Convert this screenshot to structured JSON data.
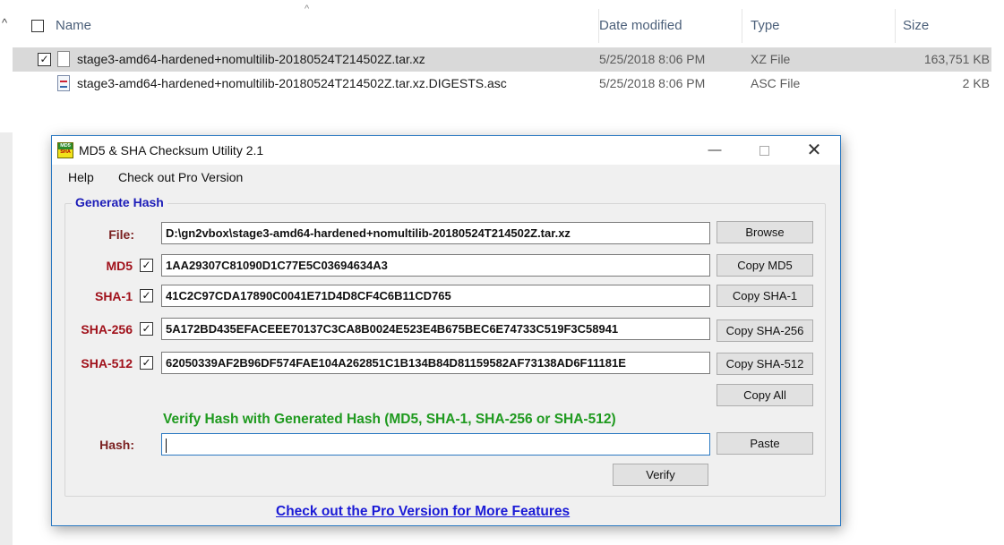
{
  "explorer": {
    "columns": {
      "name": "Name",
      "date": "Date modified",
      "type": "Type",
      "size": "Size"
    },
    "files": [
      {
        "name": "stage3-amd64-hardened+nomultilib-20180524T214502Z.tar.xz",
        "date": "5/25/2018 8:06 PM",
        "type": "XZ File",
        "size": "163,751 KB",
        "selected": true
      },
      {
        "name": "stage3-amd64-hardened+nomultilib-20180524T214502Z.tar.xz.DIGESTS.asc",
        "date": "5/25/2018 8:06 PM",
        "type": "ASC File",
        "size": "2 KB",
        "selected": false
      }
    ]
  },
  "window": {
    "title": "MD5 & SHA Checksum Utility 2.1",
    "icon_text_top": "MD5",
    "icon_text_bottom": "SHA",
    "min_glyph": "—",
    "close_glyph": "✕",
    "menu": [
      "Help",
      "Check out Pro Version"
    ]
  },
  "generate": {
    "group_title": "Generate Hash",
    "file_label": "File:",
    "file_path": "D:\\gn2vbox\\stage3-amd64-hardened+nomultilib-20180524T214502Z.tar.xz",
    "browse_label": "Browse",
    "rows": [
      {
        "label": "MD5",
        "checked": true,
        "value": "1AA29307C81090D1C77E5C03694634A3",
        "button": "Copy MD5"
      },
      {
        "label": "SHA-1",
        "checked": true,
        "value": "41C2C97CDA17890C0041E71D4D8CF4C6B11CD765",
        "button": "Copy SHA-1"
      },
      {
        "label": "SHA-256",
        "checked": true,
        "value": "5A172BD435EFACEEE70137C3CA8B0024E523E4B675BEC6E74733C519F3C58941",
        "button": "Copy SHA-256"
      },
      {
        "label": "SHA-512",
        "checked": true,
        "value": "62050339AF2B96DF574FAE104A262851C1B134B84D81159582AF73138AD6F11181E",
        "button": "Copy SHA-512"
      }
    ],
    "copy_all_label": "Copy All"
  },
  "verify": {
    "heading": "Verify Hash with Generated Hash (MD5, SHA-1, SHA-256 or SHA-512)",
    "hash_label": "Hash:",
    "hash_value": "",
    "paste_label": "Paste",
    "verify_label": "Verify"
  },
  "footer": {
    "pro_link": "Check out the Pro Version for More Features"
  },
  "colors": {
    "label_red": "#a0101a",
    "group_blue": "#1c1cb8",
    "verify_green": "#1f9a1f",
    "link_blue": "#1a1ad6",
    "window_border": "#2b79c2"
  }
}
